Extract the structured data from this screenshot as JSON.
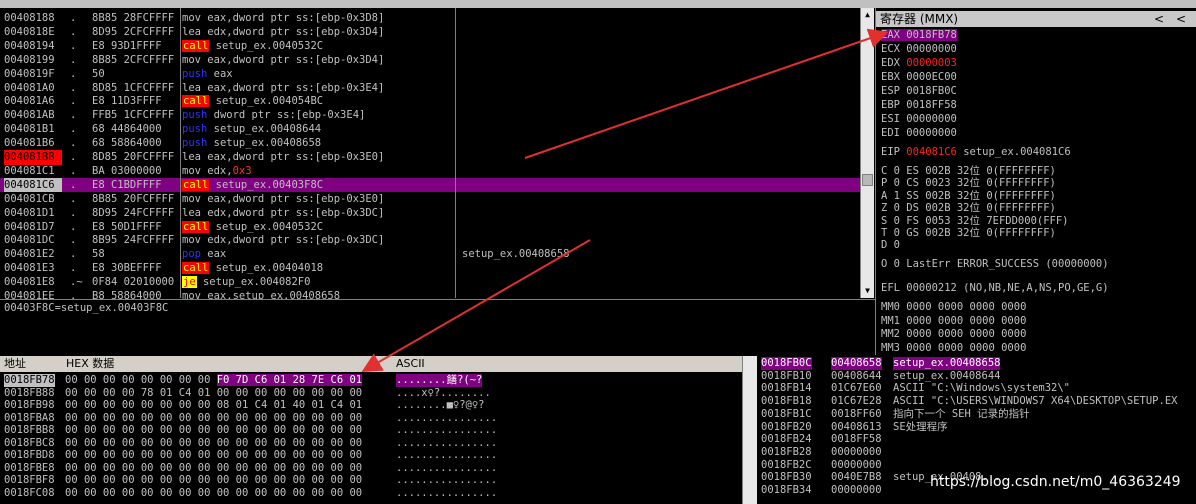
{
  "disasm": [
    {
      "addr": "00408188",
      "mk": ".",
      "hex": "8B85 28FCFFFF",
      "op": "mov",
      "rest": "eax,dword ptr ss:[ebp-0x3D8]",
      "cmt": ""
    },
    {
      "addr": "0040818E",
      "mk": ".",
      "hex": "8D95 2CFCFFFF",
      "op": "lea",
      "rest": "edx,dword ptr ss:[ebp-0x3D4]",
      "cmt": ""
    },
    {
      "addr": "00408194",
      "mk": ".",
      "hex": "E8 93D1FFFF",
      "op": "call",
      "rest": "setup_ex.0040532C",
      "cmt": ""
    },
    {
      "addr": "00408199",
      "mk": ".",
      "hex": "8B85 2CFCFFFF",
      "op": "mov",
      "rest": "eax,dword ptr ss:[ebp-0x3D4]",
      "cmt": ""
    },
    {
      "addr": "0040819F",
      "mk": ".",
      "hex": "50",
      "op": "push",
      "rest": "eax",
      "cmt": ""
    },
    {
      "addr": "004081A0",
      "mk": ".",
      "hex": "8D85 1CFCFFFF",
      "op": "lea",
      "rest": "eax,dword ptr ss:[ebp-0x3E4]",
      "cmt": ""
    },
    {
      "addr": "004081A6",
      "mk": ".",
      "hex": "E8 11D3FFFF",
      "op": "call",
      "rest": "setup_ex.004054BC",
      "cmt": ""
    },
    {
      "addr": "004081AB",
      "mk": ".",
      "hex": "FFB5 1CFCFFFF",
      "op": "push",
      "rest": "dword ptr ss:[ebp-0x3E4]",
      "cmt": ""
    },
    {
      "addr": "004081B1",
      "mk": ".",
      "hex": "68 44864000",
      "op": "push",
      "rest": "setup_ex.00408644",
      "cmt": ""
    },
    {
      "addr": "004081B6",
      "mk": ".",
      "hex": "68 58864000",
      "op": "push",
      "rest": "setup_ex.00408658",
      "cmt": ""
    },
    {
      "addr": "004081BB",
      "mk": ".",
      "hex": "8D85 20FCFFFF",
      "op": "lea",
      "rest": "eax,dword ptr ss:[ebp-0x3E0]",
      "cmt": ""
    },
    {
      "addr": "004081C1",
      "mk": ".",
      "hex": "BA 03000000",
      "op": "mov",
      "rest": "edx,",
      "imm": "0x3",
      "cmt": ""
    },
    {
      "addr": "004081C6",
      "mk": ".",
      "hex": "E8 C1BDFFFF",
      "op": "call",
      "rest": "setup_ex.00403F8C",
      "cmt": ""
    },
    {
      "addr": "004081CB",
      "mk": ".",
      "hex": "8B85 20FCFFFF",
      "op": "mov",
      "rest": "eax,dword ptr ss:[ebp-0x3E0]",
      "cmt": ""
    },
    {
      "addr": "004081D1",
      "mk": ".",
      "hex": "8D95 24FCFFFF",
      "op": "lea",
      "rest": "edx,dword ptr ss:[ebp-0x3DC]",
      "cmt": ""
    },
    {
      "addr": "004081D7",
      "mk": ".",
      "hex": "E8 50D1FFFF",
      "op": "call",
      "rest": "setup_ex.0040532C",
      "cmt": ""
    },
    {
      "addr": "004081DC",
      "mk": ".",
      "hex": "8B95 24FCFFFF",
      "op": "mov",
      "rest": "edx,dword ptr ss:[ebp-0x3DC]",
      "cmt": ""
    },
    {
      "addr": "004081E2",
      "mk": ".",
      "hex": "58",
      "op": "pop",
      "rest": "eax",
      "cmt": "setup_ex.00408658"
    },
    {
      "addr": "004081E3",
      "mk": ".",
      "hex": "E8 30BEFFFF",
      "op": "call",
      "rest": "setup_ex.00404018",
      "cmt": ""
    },
    {
      "addr": "004081E8",
      "mk": ".~",
      "hex": "0F84 02010000",
      "op": "je",
      "rest": "setup_ex.004082F0",
      "cmt": ""
    },
    {
      "addr": "004081EE",
      "mk": ".",
      "hex": "B8 58864000",
      "op": "mov",
      "rest": "eax,setup_ex.00408658",
      "cmt": ""
    }
  ],
  "info_line": "00403F8C=setup_ex.00403F8C",
  "registers": {
    "header": "寄存器 (MMX)",
    "nav_left": "<",
    "nav_right": "<",
    "eax": "EAX 0018FB78",
    "ecx": "ECX 00000000",
    "edx_name": "EDX",
    "edx_val": "00000003",
    "ebx": "EBX 0000EC00",
    "esp": "ESP 0018FB0C",
    "ebp": "EBP 0018FF58",
    "esi": "ESI 00000000",
    "edi": "EDI 00000000",
    "eip_name": "EIP",
    "eip_val": "004081C6",
    "eip_sym": "setup_ex.004081C6",
    "flags": [
      "C 0  ES 002B 32位 0(FFFFFFFF)",
      "P 0  CS 0023 32位 0(FFFFFFFF)",
      "A 1  SS 002B 32位 0(FFFFFFFF)",
      "Z 0  DS 002B 32位 0(FFFFFFFF)",
      "S 0  FS 0053 32位 7EFDD000(FFF)",
      "T 0  GS 002B 32位 0(FFFFFFFF)",
      "D 0",
      "O 0  LastErr ERROR_SUCCESS (00000000)"
    ],
    "efl": "EFL 00000212 (NO,NB,NE,A,NS,PO,GE,G)",
    "mm": [
      "MM0 0000 0000 0000 0000",
      "MM1 0000 0000 0000 0000",
      "MM2 0000 0000 0000 0000",
      "MM3 0000 0000 0000 0000"
    ]
  },
  "dump": {
    "col_addr": "地址",
    "col_hex": "HEX 数据",
    "col_ascii": "ASCII",
    "rows": [
      {
        "a": "0018FB78",
        "b": "00 00 00 00 00 00 00 00 F0 7D C6 01 28 7E C6 01",
        "s": "........饍?(~?"
      },
      {
        "a": "0018FB88",
        "b": "00 00 00 00 78 01 C4 01 00 00 00 00 00 00 00 00",
        "s": "....x♀?........"
      },
      {
        "a": "0018FB98",
        "b": "00 00 00 00 00 00 00 00 08 01 C4 01 40 01 C4 01",
        "s": "........■♀?@♀?"
      },
      {
        "a": "0018FBA8",
        "b": "00 00 00 00 00 00 00 00 00 00 00 00 00 00 00 00",
        "s": "................"
      },
      {
        "a": "0018FBB8",
        "b": "00 00 00 00 00 00 00 00 00 00 00 00 00 00 00 00",
        "s": "................"
      },
      {
        "a": "0018FBC8",
        "b": "00 00 00 00 00 00 00 00 00 00 00 00 00 00 00 00",
        "s": "................"
      },
      {
        "a": "0018FBD8",
        "b": "00 00 00 00 00 00 00 00 00 00 00 00 00 00 00 00",
        "s": "................"
      },
      {
        "a": "0018FBE8",
        "b": "00 00 00 00 00 00 00 00 00 00 00 00 00 00 00 00",
        "s": "................"
      },
      {
        "a": "0018FBF8",
        "b": "00 00 00 00 00 00 00 00 00 00 00 00 00 00 00 00",
        "s": "................"
      },
      {
        "a": "0018FC08",
        "b": "00 00 00 00 00 00 00 00 00 00 00 00 00 00 00 00",
        "s": "................"
      }
    ]
  },
  "stack": [
    {
      "a": "0018FB0C",
      "v": "00408658",
      "c": "setup_ex.00408658"
    },
    {
      "a": "0018FB10",
      "v": "00408644",
      "c": "setup_ex.00408644"
    },
    {
      "a": "0018FB14",
      "v": "01C67E60",
      "c": "ASCII \"C:\\Windows\\system32\\\""
    },
    {
      "a": "0018FB18",
      "v": "01C67E28",
      "c": "ASCII \"C:\\USERS\\WINDOWS7 X64\\DESKTOP\\SETUP.EX"
    },
    {
      "a": "0018FB1C",
      "v": "0018FF60",
      "c": "指向下一个 SEH 记录的指针"
    },
    {
      "a": "0018FB20",
      "v": "00408613",
      "c": "SE处理程序"
    },
    {
      "a": "0018FB24",
      "v": "0018FF58",
      "c": ""
    },
    {
      "a": "0018FB28",
      "v": "00000000",
      "c": ""
    },
    {
      "a": "0018FB2C",
      "v": "00000000",
      "c": ""
    },
    {
      "a": "0018FB30",
      "v": "0040E7B8",
      "c": "setup_ex.00408..."
    },
    {
      "a": "0018FB34",
      "v": "00000000",
      "c": ""
    }
  ],
  "watermark": "https://blog.csdn.net/m0_46363249",
  "colors": {
    "selection": "#7f0080",
    "call_bg": "#ff0000",
    "call_fg": "#ffff00",
    "arrow": "#e03030"
  }
}
